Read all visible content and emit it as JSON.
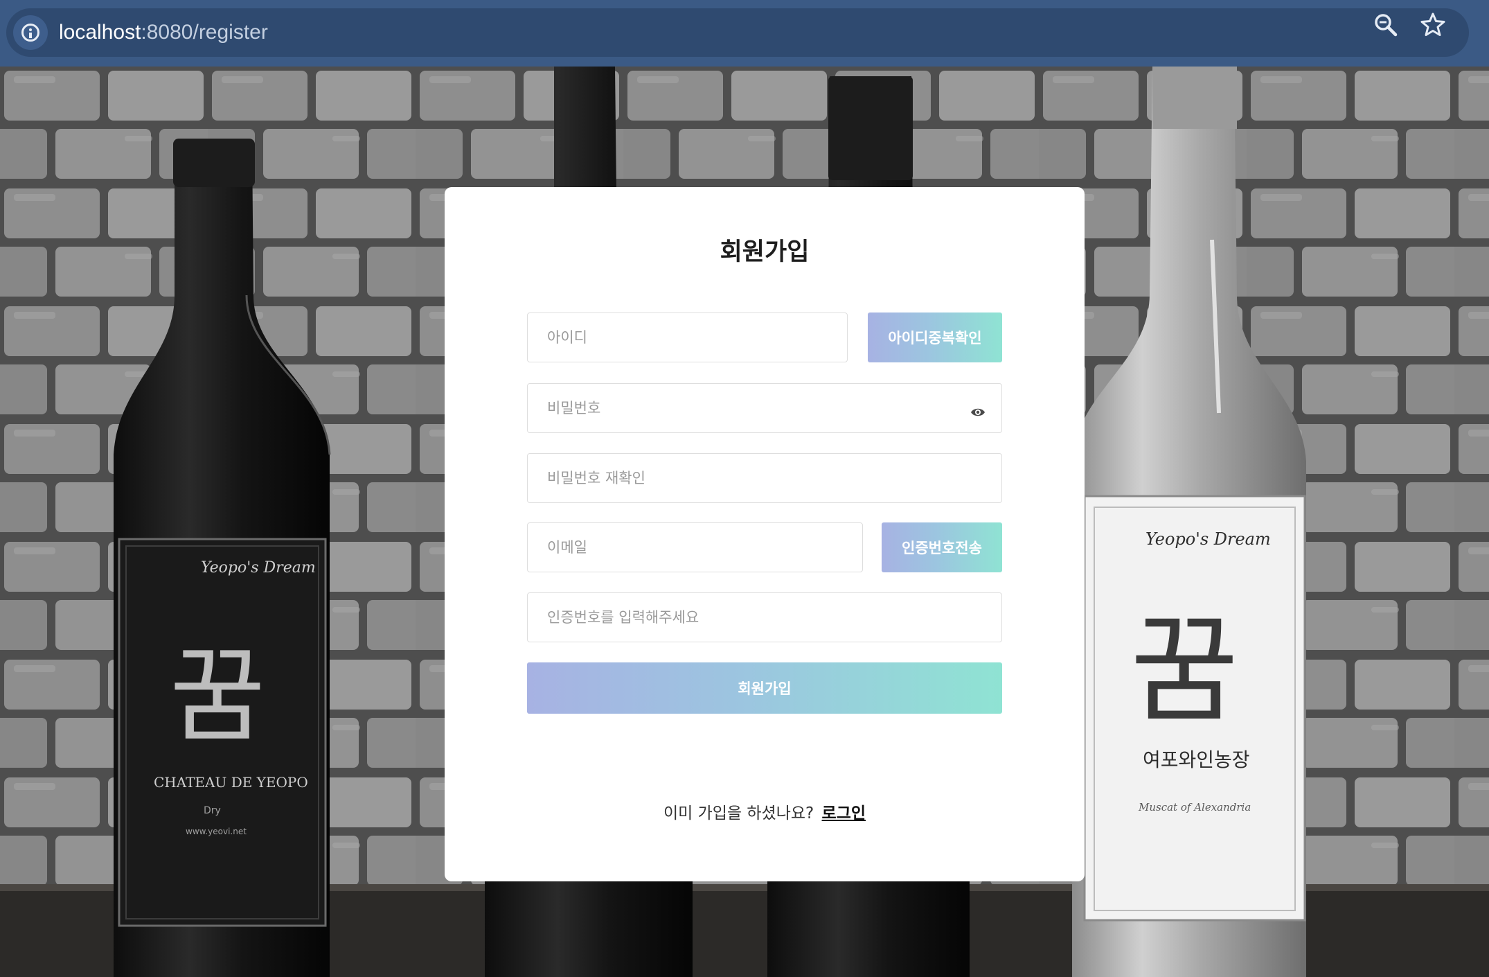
{
  "browser": {
    "url_host": "localhost",
    "url_path": ":8080/register",
    "icons": [
      "site-info-icon",
      "zoom-icon",
      "bookmark-star-icon"
    ]
  },
  "form": {
    "title": "회원가입",
    "id_placeholder": "아이디",
    "id_check_label": "아이디중복확인",
    "password_placeholder": "비밀번호",
    "password_confirm_placeholder": "비밀번호 재확인",
    "email_placeholder": "이메일",
    "send_code_label": "인증번호전송",
    "code_placeholder": "인증번호를 입력해주세요",
    "submit_label": "회원가입",
    "already_text": "이미 가입을 하셨나요?",
    "login_link": "로그인"
  },
  "background": {
    "left_label": "Yeopo's Dream",
    "left_label_sub": "CHATEAU DE YEOPO",
    "left_label_small": "Dry",
    "left_label_url": "www.yeovi.net",
    "right_label": "Yeopo's Dream",
    "right_label_sub": "여포와인농장",
    "right_label_small": "Muscat of Alexandria",
    "logo_glyph": "꿈"
  },
  "colors": {
    "chrome": "#3b5a85",
    "omnibox": "#2f4a70",
    "gradient_start": "#a7b2e3",
    "gradient_end": "#8fe3d3"
  }
}
